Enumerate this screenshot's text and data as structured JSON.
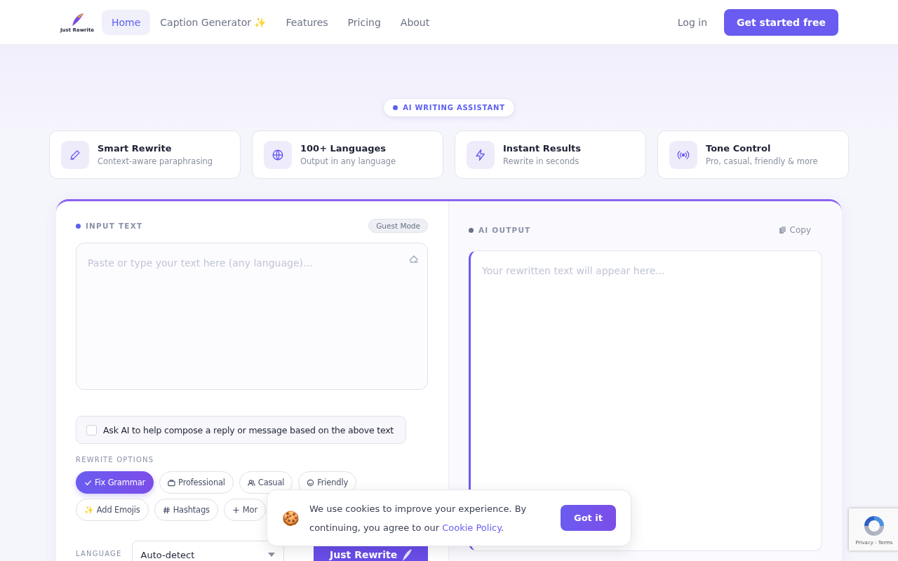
{
  "header": {
    "logo_text": "Just Rewrite",
    "nav": [
      {
        "label": "Home",
        "selected": true
      },
      {
        "label": "Caption Generator ✨",
        "selected": false
      },
      {
        "label": "Features",
        "selected": false
      },
      {
        "label": "Pricing",
        "selected": false
      },
      {
        "label": "About",
        "selected": false
      }
    ],
    "login": "Log in",
    "cta": "Get started free"
  },
  "hero": {
    "badge": "AI WRITING ASSISTANT"
  },
  "features": [
    {
      "kind": "pen",
      "title": "Smart Rewrite",
      "subtitle": "Context-aware paraphrasing"
    },
    {
      "kind": "globe",
      "title": "100+ Languages",
      "subtitle": "Output in any language"
    },
    {
      "kind": "bolt",
      "title": "Instant Results",
      "subtitle": "Rewrite in seconds"
    },
    {
      "kind": "tone",
      "title": "Tone Control",
      "subtitle": "Pro, casual, friendly & more"
    }
  ],
  "input": {
    "label": "INPUT TEXT",
    "mode": "Guest Mode",
    "placeholder": "Paste or type your text here (any language)...",
    "compose": {
      "label": "Ask AI to help compose a reply or message based on the above text",
      "checked": false
    },
    "options_label": "REWRITE OPTIONS",
    "options": [
      {
        "kind": "check",
        "label": "Fix Grammar",
        "selected": true
      },
      {
        "kind": "briefcase",
        "label": "Professional",
        "selected": false
      },
      {
        "kind": "people",
        "label": "Casual",
        "selected": false
      },
      {
        "kind": "smile",
        "label": "Friendly",
        "selected": false
      },
      {
        "kind": "sparkle",
        "icon": "✨",
        "label": "Add Emojis",
        "selected": false
      },
      {
        "kind": "hash",
        "label": "Hashtags",
        "selected": false
      },
      {
        "kind": "plus",
        "label": "Mor",
        "selected": false
      }
    ],
    "language_label": "LANGUAGE",
    "language": "Auto-detect",
    "submit": "Just Rewrite"
  },
  "output": {
    "label": "AI OUTPUT",
    "copy": "Copy",
    "placeholder": "Your rewritten text will appear here..."
  },
  "cookie": {
    "icon": "🍪",
    "text": "We use cookies to improve your experience. By continuing, you agree to our ",
    "link": "Cookie Policy",
    "end": ".",
    "button": "Got it"
  },
  "recaptcha": {
    "links": "Privacy - Terms"
  }
}
